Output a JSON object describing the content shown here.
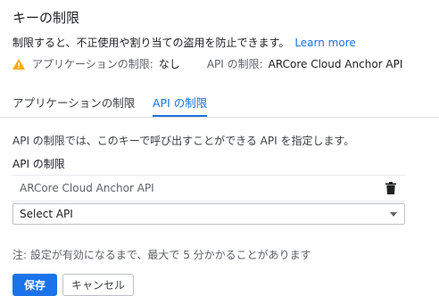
{
  "section": {
    "title": "キーの制限",
    "description": "制限すると、不正使用や割り当ての盗用を防止できます。",
    "learn_more": "Learn more"
  },
  "restriction_summary": {
    "app_label": "アプリケーションの制限:",
    "app_value": "なし",
    "api_label": "API の制限:",
    "api_value": "ARCore Cloud Anchor API"
  },
  "tabs": [
    {
      "label": "アプリケーションの制限",
      "active": false
    },
    {
      "label": "API の制限",
      "active": true
    }
  ],
  "api_tab": {
    "info": "API の制限では、このキーで呼び出すことができる API を指定します。",
    "section_label": "API の制限",
    "apis": [
      {
        "name": "ARCore Cloud Anchor API"
      }
    ],
    "select_value": "Select API"
  },
  "note": "注: 設定が有効になるまで、最大で 5 分かかることがあります",
  "buttons": {
    "save": "保存",
    "cancel": "キャンセル"
  },
  "colors": {
    "accent": "#1a73e8",
    "warning": "#f9ab00"
  }
}
